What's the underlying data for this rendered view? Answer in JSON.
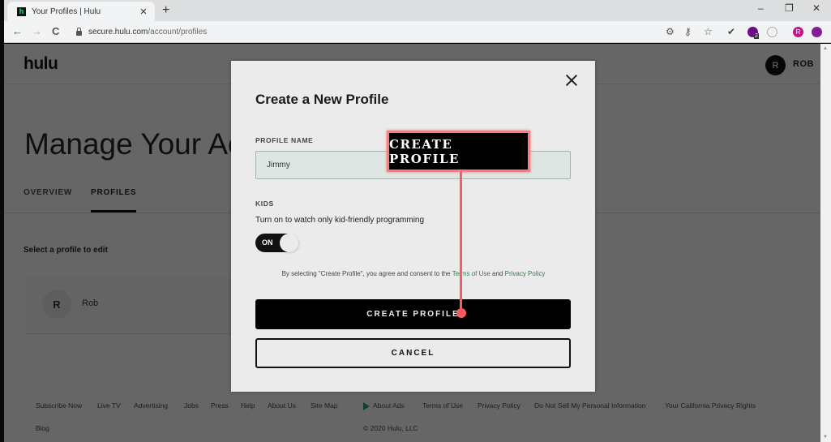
{
  "browser": {
    "tab_title": "Your Profiles | Hulu",
    "favicon_letter": "h",
    "new_tab_label": "+",
    "url_host": "secure.hulu.com",
    "url_path": "/account/profiles",
    "minimize": "–",
    "maximize": "❐",
    "close": "✕",
    "back": "←",
    "forward": "→",
    "reload": "C",
    "extension_badge": "2",
    "profile_initial": "R",
    "icons": [
      "cookie-icon",
      "key-icon",
      "star-icon",
      "extension-bird-icon",
      "extension-badge-icon",
      "compass-icon",
      "profile-avatar-icon",
      "extension-purple-icon"
    ]
  },
  "header": {
    "logo": "hulu",
    "user_initial": "R",
    "user_name": "ROB"
  },
  "page": {
    "title": "Manage Your Account",
    "tabs": [
      {
        "label": "OVERVIEW",
        "active": false
      },
      {
        "label": "PROFILES",
        "active": true
      }
    ],
    "select_label": "Select a profile to edit",
    "profiles": [
      {
        "initial": "R",
        "name": "Rob"
      }
    ]
  },
  "footer": {
    "links_row1": [
      "Subscribe Now",
      "Live TV",
      "Advertising",
      "Jobs",
      "Press",
      "Help",
      "About Us",
      "Site Map",
      "About Ads",
      "Terms of Use",
      "Privacy Policy",
      "Do Not Sell My Personal Information",
      "Your California Privacy Rights"
    ],
    "links_row2": [
      "Blog"
    ],
    "copyright": "© 2020 Hulu, LLC"
  },
  "modal": {
    "title": "Create a New Profile",
    "profile_name_label": "PROFILE NAME",
    "profile_name_value": "Jimmy",
    "kids_label": "KIDS",
    "kids_description": "Turn on to watch only kid-friendly programming",
    "kids_toggle_label": "ON",
    "kids_toggle_on": true,
    "consent_prefix": "By selecting \"Create Profile\", you agree and consent to the ",
    "consent_terms": "Terms of Use",
    "consent_and": " and ",
    "consent_privacy": "Privacy Policy",
    "create_button": "CREATE PROFILE",
    "cancel_button": "CANCEL"
  },
  "annotation": {
    "label": "CREATE PROFILE",
    "color": "#ff5a5f"
  }
}
